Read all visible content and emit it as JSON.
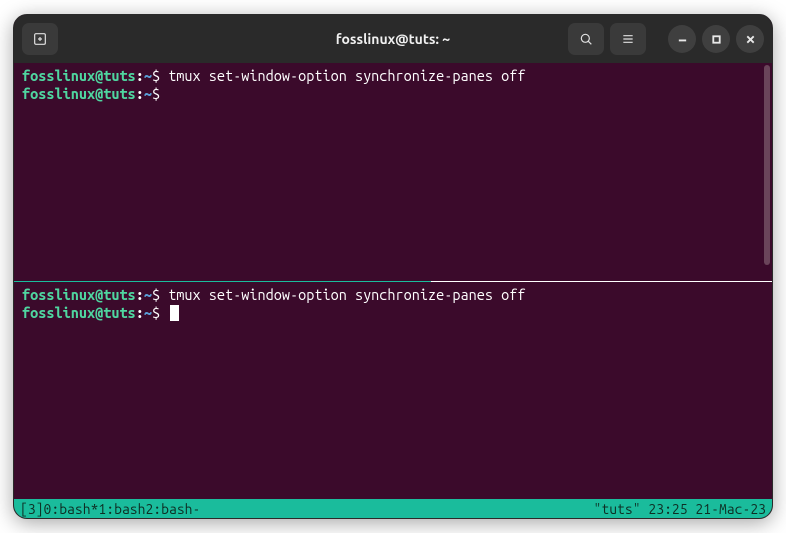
{
  "titlebar": {
    "title": "fosslinux@tuts: ~"
  },
  "panes": [
    {
      "lines": [
        {
          "user": "fosslinux@tuts",
          "colon": ":",
          "path": "~",
          "dollar": "$ ",
          "cmd": "tmux set-window-option synchronize-panes off"
        },
        {
          "user": "fosslinux@tuts",
          "colon": ":",
          "path": "~",
          "dollar": "$ ",
          "cmd": ""
        }
      ]
    },
    {
      "lines": [
        {
          "user": "fosslinux@tuts",
          "colon": ":",
          "path": "~",
          "dollar": "$ ",
          "cmd": "tmux set-window-option synchronize-panes off"
        },
        {
          "user": "fosslinux@tuts",
          "colon": ":",
          "path": "~",
          "dollar": "$ ",
          "cmd": ""
        }
      ]
    }
  ],
  "statusbar": {
    "session": "[3] ",
    "win0": "0:bash* ",
    "win1": "1:bash  ",
    "win2": "2:bash-",
    "right": "\"tuts\" 23:25 21-Mac-23"
  },
  "colors": {
    "terminal_bg": "#3b0a2b",
    "status_bg": "#1abc9c",
    "prompt_user": "#4fd6a0",
    "prompt_path": "#5a9ed6"
  }
}
